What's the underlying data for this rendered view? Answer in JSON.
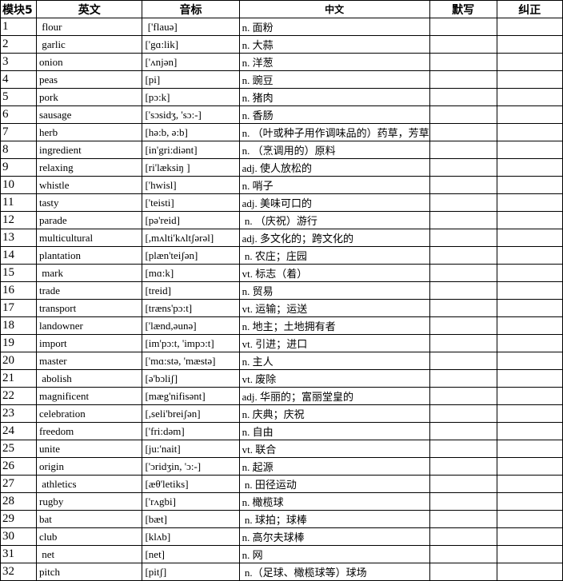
{
  "headers": [
    "模块5",
    "英文",
    "音标",
    "中文",
    "默写",
    "纠正"
  ],
  "rows": [
    {
      "no": "1",
      "en": " flour",
      "ipa": " ['flauə]",
      "zh": "n. 面粉"
    },
    {
      "no": "2",
      "en": " garlic",
      "ipa": "['gɑ:lik]",
      "zh": "n. 大蒜"
    },
    {
      "no": "3",
      "en": "onion",
      "ipa": "['ʌnjən]",
      "zh": "n. 洋葱"
    },
    {
      "no": "4",
      "en": "peas",
      "ipa": "[pi]",
      "zh": "n. 豌豆"
    },
    {
      "no": "5",
      "en": "pork",
      "ipa": "[pɔ:k]",
      "zh": "n. 猪肉"
    },
    {
      "no": "6",
      "en": "sausage",
      "ipa": "['sɔsidʒ, 'sɔ:-]",
      "zh": "n. 香肠"
    },
    {
      "no": "7",
      "en": "herb",
      "ipa": "[hə:b, ə:b]",
      "zh": "n. （叶或种子用作调味品的）药草，芳草"
    },
    {
      "no": "8",
      "en": "ingredient",
      "ipa": "[in'gri:diənt]",
      "zh": "n. （烹调用的）原料"
    },
    {
      "no": "9",
      "en": "relaxing",
      "ipa": "[ri'læksiŋ ]",
      "zh": "adj. 使人放松的"
    },
    {
      "no": "10",
      "en": "whistle",
      "ipa": "['hwisl]",
      "zh": "n. 哨子"
    },
    {
      "no": "11",
      "en": "tasty",
      "ipa": "['teisti]",
      "zh": "adj. 美味可口的"
    },
    {
      "no": "12",
      "en": "parade",
      "ipa": "[pə'reid]",
      "zh": " n. （庆祝）游行"
    },
    {
      "no": "13",
      "en": "multicultural",
      "ipa": "[,mʌlti'kʌltʃərəl]",
      "zh": "adj. 多文化的；跨文化的"
    },
    {
      "no": "14",
      "en": "plantation",
      "ipa": "[plæn'teiʃən]",
      "zh": " n. 农庄；庄园"
    },
    {
      "no": "15",
      "en": " mark",
      "ipa": "[mɑ:k]",
      "zh": "vt. 标志（着）"
    },
    {
      "no": "16",
      "en": "trade",
      "ipa": "[treid]",
      "zh": "n. 贸易"
    },
    {
      "no": "17",
      "en": "transport",
      "ipa": "[træns'pɔ:t]",
      "zh": "vt. 运输；运送"
    },
    {
      "no": "18",
      "en": "landowner",
      "ipa": "['lænd,əunə]",
      "zh": "n. 地主；土地拥有者"
    },
    {
      "no": "19",
      "en": "import",
      "ipa": "[im'pɔ:t, 'impɔ:t]",
      "zh": "vt. 引进；进口"
    },
    {
      "no": "20",
      "en": "master",
      "ipa": "['mɑ:stə, 'mæstə]",
      "zh": "n. 主人"
    },
    {
      "no": "21",
      "en": " abolish",
      "ipa": "[ə'bɔliʃ]",
      "zh": "vt. 废除"
    },
    {
      "no": "22",
      "en": "magnificent",
      "ipa": "[mæg'nifisənt]",
      "zh": "adj. 华丽的；富丽堂皇的"
    },
    {
      "no": "23",
      "en": "celebration",
      "ipa": "[,seli'breiʃən]",
      "zh": "n. 庆典；庆祝"
    },
    {
      "no": "24",
      "en": "freedom",
      "ipa": "['fri:dəm]",
      "zh": "n. 自由"
    },
    {
      "no": "25",
      "en": "unite",
      "ipa": "[ju:'nait]",
      "zh": "vt. 联合"
    },
    {
      "no": "26",
      "en": "origin",
      "ipa": "['ɔridʒin, 'ɔ:-]",
      "zh": "n. 起源"
    },
    {
      "no": "27",
      "en": " athletics",
      "ipa": "[æθ'letiks]",
      "zh": " n. 田径运动"
    },
    {
      "no": "28",
      "en": "rugby",
      "ipa": "['rʌgbi]",
      "zh": "n. 橄榄球"
    },
    {
      "no": "29",
      "en": "bat",
      "ipa": "[bæt]",
      "zh": " n. 球拍；球棒"
    },
    {
      "no": "30",
      "en": "club",
      "ipa": "[klʌb]",
      "zh": "n. 高尔夫球棒"
    },
    {
      "no": "31",
      "en": " net",
      "ipa": "[net]",
      "zh": "n. 网"
    },
    {
      "no": "32",
      "en": "pitch",
      "ipa": "[pitʃ]",
      "zh": " n.（足球、橄榄球等）球场"
    }
  ]
}
